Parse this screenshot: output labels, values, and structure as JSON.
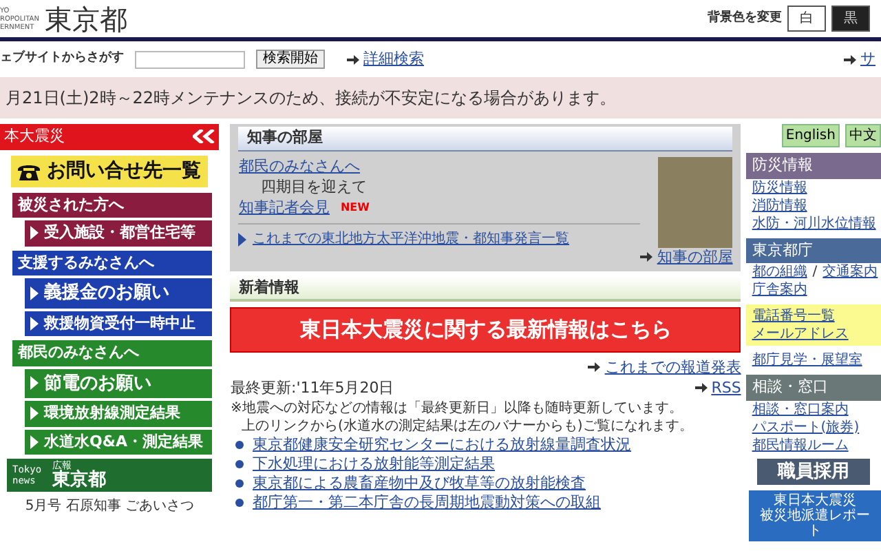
{
  "header": {
    "logo_lines": [
      "YO",
      "ROPOLITAN",
      "ERNMENT"
    ],
    "logo_title": "東京都",
    "bg_label": "背景色を変更",
    "bg_buttons": [
      {
        "label": "白",
        "kind": "white"
      },
      {
        "label": "黒",
        "kind": "black"
      }
    ]
  },
  "search": {
    "label": "ェブサイトからさがす",
    "button": "検索開始",
    "advanced_link": "詳細検索",
    "right_link": "サ"
  },
  "notice": "月21日(土)2時～22時メンテナンスのため、接続が不安定になる場合があります。",
  "left": {
    "title": "本大震災",
    "contact": "お問い合せ先一覧",
    "sections": [
      {
        "heading": "被災された方へ",
        "color": "#8a1c40",
        "items": [
          {
            "label": "受入施設・都営住宅等",
            "emphasis": false
          }
        ]
      },
      {
        "heading": "支援するみなさんへ",
        "color": "#1e3fae",
        "items": [
          {
            "label": "義援金のお願い",
            "emphasis": true
          },
          {
            "label": "救援物資受付一時中止",
            "emphasis": false
          }
        ]
      },
      {
        "heading": "都民のみなさんへ",
        "color": "#268a2c",
        "items": [
          {
            "label": "節電のお願い",
            "emphasis": true
          },
          {
            "label": "環境放射線測定結果",
            "emphasis": false
          },
          {
            "label": "水道水Q&A・測定結果",
            "emphasis": false
          }
        ]
      }
    ],
    "news_banner": {
      "lines": [
        "Tokyo",
        "news"
      ],
      "small": "広報",
      "title": "東京都"
    },
    "caption": "5月号 石原知事 ごあいさつ"
  },
  "center": {
    "governor": {
      "title": "知事の部屋",
      "lines": [
        {
          "text": "都民のみなさんへ",
          "kind": "link"
        },
        {
          "text": "四期目を迎えて",
          "kind": "text"
        },
        {
          "text": "知事記者会見",
          "kind": "link",
          "badge": "NEW"
        }
      ],
      "archive_link": "これまでの東北地方太平洋沖地震・都知事発言一覧",
      "room_link": "知事の部屋"
    },
    "news": {
      "title": "新着情報",
      "banner": "東日本大震災に関する最新情報はこちら",
      "press_link": "これまでの報道発表",
      "updated": "最終更新:'11年5月20日",
      "rss": "RSS",
      "notes": [
        "※地震への対応などの情報は「最終更新日」以降も随時更新しています。",
        "上のリンクから(水道水の測定結果は左のバナーからも)ご覧になれます。"
      ],
      "items": [
        "東京都健康安全研究センターにおける放射線量調査状況",
        "下水処理における放射能等測定結果",
        "東京都による農畜産物中及び牧草等の放射能検査",
        "都庁第一・第二本庁舎の長周期地震動対策への取組"
      ]
    }
  },
  "right": {
    "languages": [
      "English",
      "中文"
    ],
    "disaster": {
      "heading": "防災情報",
      "links": [
        "防災情報",
        "消防情報",
        "水防・河川水位情報"
      ]
    },
    "office": {
      "heading": "東京都庁",
      "org_link": "都の組織",
      "separator": "/",
      "transit_link": "交通案内",
      "hall_link": "庁舎案内",
      "highlight_links": [
        "電話番号一覧",
        "メールアドレス"
      ],
      "tour_link": "都庁見学・展望室"
    },
    "consult": {
      "heading": "相談・窓口",
      "links": [
        "相談・窓口案内",
        "パスポート(旅券)",
        "都民情報ルーム"
      ]
    },
    "recruit_banner": "職員採用",
    "report_banner": [
      "東日本大震災",
      "被災地派遣レポート"
    ]
  }
}
